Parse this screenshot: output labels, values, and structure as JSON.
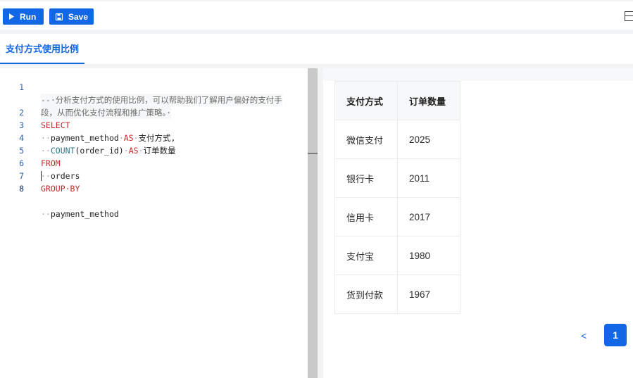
{
  "toolbar": {
    "run_label": "Run",
    "save_label": "Save",
    "accent_color": "#1167e6",
    "layout_icon": "split-layout-icon"
  },
  "tab": {
    "title": "支付方式使用比例"
  },
  "editor": {
    "lines": [
      {
        "num": "1",
        "text": "--·分析支付方式的使用比例，可以帮助我们了解用户偏好的支付手"
      },
      {
        "num": "",
        "text": "段，从而优化支付流程和推广策略。·"
      },
      {
        "num": "2",
        "text": "SELECT"
      },
      {
        "num": "3",
        "text": "··payment_method·AS·支付方式,"
      },
      {
        "num": "4",
        "text": "··COUNT(order_id)·AS·订单数量"
      },
      {
        "num": "5",
        "text": "FROM"
      },
      {
        "num": "6",
        "text": "··orders"
      },
      {
        "num": "7",
        "text": "GROUP·BY"
      },
      {
        "num": "8",
        "text": "··payment_method"
      }
    ]
  },
  "result": {
    "columns": [
      "支付方式",
      "订单数量"
    ],
    "rows": [
      [
        "微信支付",
        "2025"
      ],
      [
        "银行卡",
        "2011"
      ],
      [
        "信用卡",
        "2017"
      ],
      [
        "支付宝",
        "1980"
      ],
      [
        "货到付款",
        "1967"
      ]
    ],
    "pagination": {
      "prev_symbol": "<",
      "current_page": "1"
    }
  }
}
